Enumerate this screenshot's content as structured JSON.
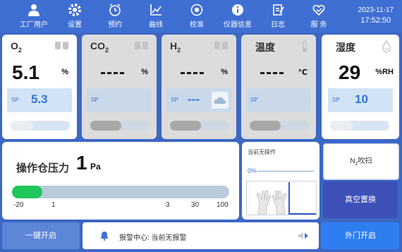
{
  "nav": [
    {
      "label": "工厂用户",
      "icon": "user-icon"
    },
    {
      "label": "设置",
      "icon": "gear-icon"
    },
    {
      "label": "预约",
      "icon": "alarm-clock-icon"
    },
    {
      "label": "曲线",
      "icon": "chart-icon"
    },
    {
      "label": "校准",
      "icon": "target-icon"
    },
    {
      "label": "仪器信息",
      "icon": "info-icon"
    },
    {
      "label": "日志",
      "icon": "log-icon"
    },
    {
      "label": "服 务",
      "icon": "heart-service-icon"
    }
  ],
  "datetime": {
    "date": "2023-11-17",
    "time": "17:52:50"
  },
  "gases": [
    {
      "name": "O",
      "sub": "2",
      "value": "5.1",
      "unit": "%",
      "sp_label": "SP",
      "sp_value": "5.3"
    },
    {
      "name": "CO",
      "sub": "2",
      "value": "----",
      "unit": "%",
      "sp_label": "SP",
      "sp_value": ""
    },
    {
      "name": "H",
      "sub": "2",
      "value": "----",
      "unit": "%",
      "sp_label": "SP",
      "sp_value": "---"
    },
    {
      "name": "温度",
      "sub": "",
      "value": "----",
      "unit": "℃",
      "sp_label": "SP",
      "sp_value": ""
    },
    {
      "name": "湿度",
      "sub": "",
      "value": "29",
      "unit": "%RH",
      "sp_label": "SP",
      "sp_value": "10"
    }
  ],
  "pressure": {
    "title": "操作仓压力",
    "value": "1",
    "unit": "Pa",
    "fill_fraction": 0.14,
    "ticks": [
      "-20",
      "1",
      "3",
      "30",
      "100"
    ]
  },
  "ops": {
    "status": "当前无操作",
    "percent": "0%"
  },
  "buttons": {
    "purge_prefix": "N",
    "purge_sub": "2",
    "purge_suffix": "吹扫",
    "vacuum": "真空置换",
    "start": "一键开启",
    "door": "外门开启"
  },
  "alarm": {
    "text": "报警中心: 当前无报警"
  },
  "colors": {
    "topbar": "#3f6fd3",
    "green": "#1fc65a",
    "accent_blue": "#2f75d6",
    "dark_btn": "#3d50b8"
  }
}
